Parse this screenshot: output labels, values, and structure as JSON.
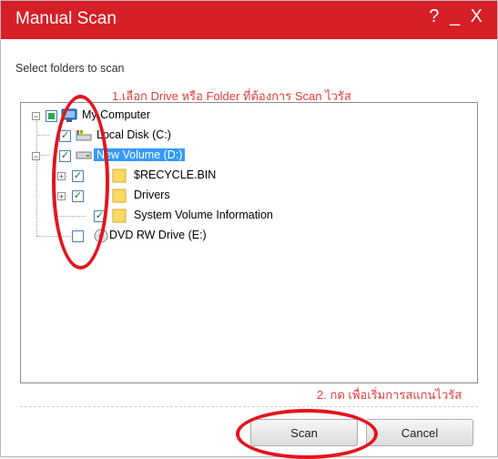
{
  "window": {
    "title": "Manual Scan",
    "help_label": "?",
    "minimize_label": "_",
    "close_label": "X"
  },
  "instruction": "Select folders to scan",
  "annotations": {
    "step1": "1.เลือก Drive หรือ Folder ที่ต้องการ Scan ไวรัส",
    "step2": "2. กด เพื่อเริ่มการสแกนไวรัส"
  },
  "tree": {
    "root": "My Computer",
    "drive_c": "Local Disk (C:)",
    "drive_d": "New Volume (D:)",
    "folder1": "$RECYCLE.BIN",
    "folder2": "Drivers",
    "folder3": "System Volume Information",
    "drive_e": "DVD RW Drive (E:)"
  },
  "buttons": {
    "scan": "Scan",
    "cancel": "Cancel"
  },
  "colors": {
    "titlebar": "#d61f26",
    "annotation": "#e23b3b",
    "selection": "#3399ff"
  }
}
